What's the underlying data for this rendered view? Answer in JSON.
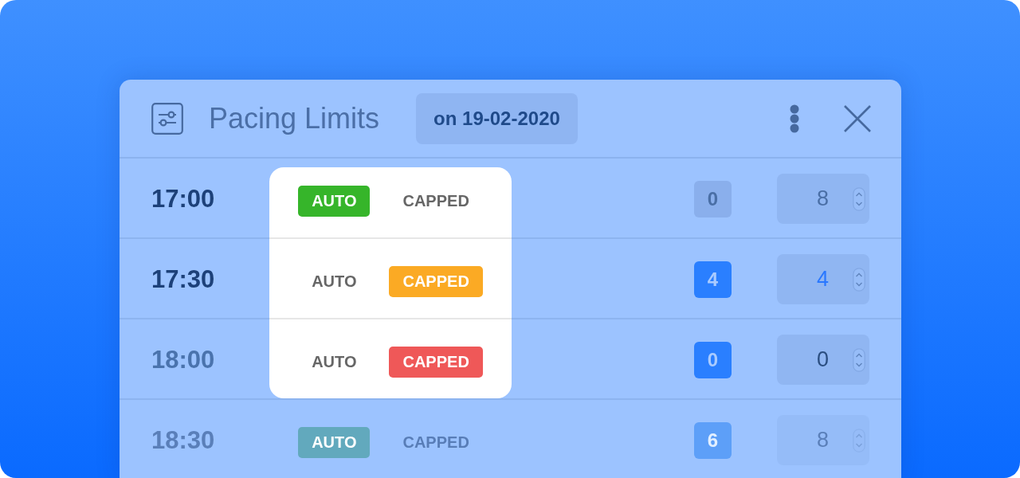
{
  "window": {
    "title": "Pacing Limits",
    "date": "on 19-02-2020"
  },
  "rows": [
    {
      "time": "17:00",
      "time_muted": false,
      "faded": false,
      "highlighted": true,
      "mode": [
        {
          "label": "AUTO",
          "selected": true,
          "color": "#36b52a"
        },
        {
          "label": "CAPPED",
          "selected": false
        }
      ],
      "count": {
        "text": "0",
        "active": false
      },
      "limit": {
        "value": "8",
        "muted": true,
        "accent": false
      }
    },
    {
      "time": "17:30",
      "time_muted": false,
      "faded": false,
      "highlighted": true,
      "mode": [
        {
          "label": "AUTO",
          "selected": false
        },
        {
          "label": "CAPPED",
          "selected": true,
          "color": "#fbaa24"
        }
      ],
      "count": {
        "text": "4",
        "active": true
      },
      "limit": {
        "value": "4",
        "muted": false,
        "accent": true
      }
    },
    {
      "time": "18:00",
      "time_muted": true,
      "faded": false,
      "highlighted": true,
      "mode": [
        {
          "label": "AUTO",
          "selected": false
        },
        {
          "label": "CAPPED",
          "selected": true,
          "color": "#ef5858"
        }
      ],
      "count": {
        "text": "0",
        "active": true
      },
      "limit": {
        "value": "0",
        "muted": false,
        "accent": false
      }
    },
    {
      "time": "18:30",
      "time_muted": false,
      "faded": true,
      "highlighted": false,
      "mode": [
        {
          "label": "AUTO",
          "selected": true,
          "color": "#62a9bd"
        },
        {
          "label": "CAPPED",
          "selected": false
        }
      ],
      "count": {
        "text": "6",
        "active": true
      },
      "limit": {
        "value": "8",
        "muted": true,
        "accent": false
      }
    }
  ]
}
